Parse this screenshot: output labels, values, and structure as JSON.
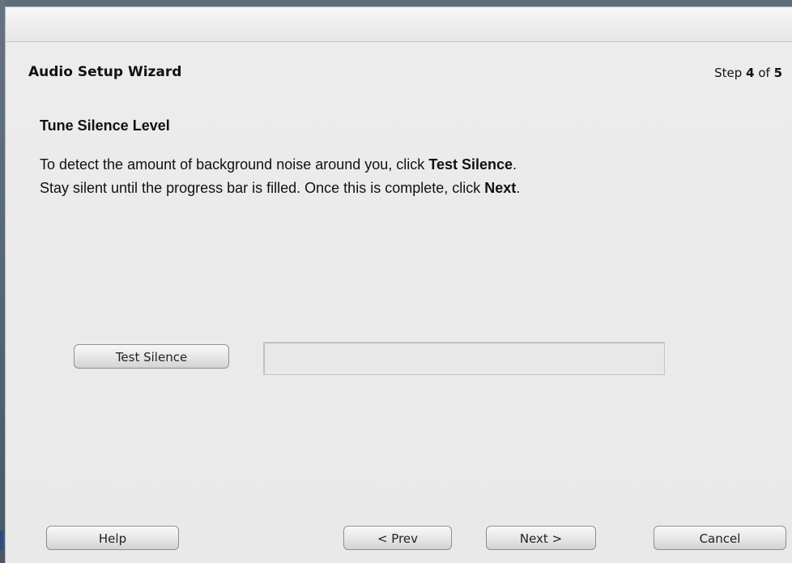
{
  "wizard": {
    "title": "Audio Setup Wizard",
    "step_prefix": "Step",
    "step_current": "4",
    "step_of": "of",
    "step_total": "5"
  },
  "content": {
    "heading": "Tune Silence Level",
    "line1_prefix": "To detect the amount of background noise around you, click",
    "line1_bold": "Test Silence",
    "line1_suffix": ".",
    "line2_prefix": "Stay silent until the progress bar is filled. Once this is complete, click",
    "line2_bold": "Next",
    "line2_suffix": "."
  },
  "controls": {
    "test_silence_label": "Test Silence",
    "progress_fraction": 0
  },
  "footer": {
    "help_label": "Help",
    "prev_label": "< Prev",
    "next_label": "Next >",
    "cancel_label": "Cancel"
  },
  "colors": {
    "panel_background": "#e9e9e9",
    "progress_fill": "#7fa8d9"
  }
}
